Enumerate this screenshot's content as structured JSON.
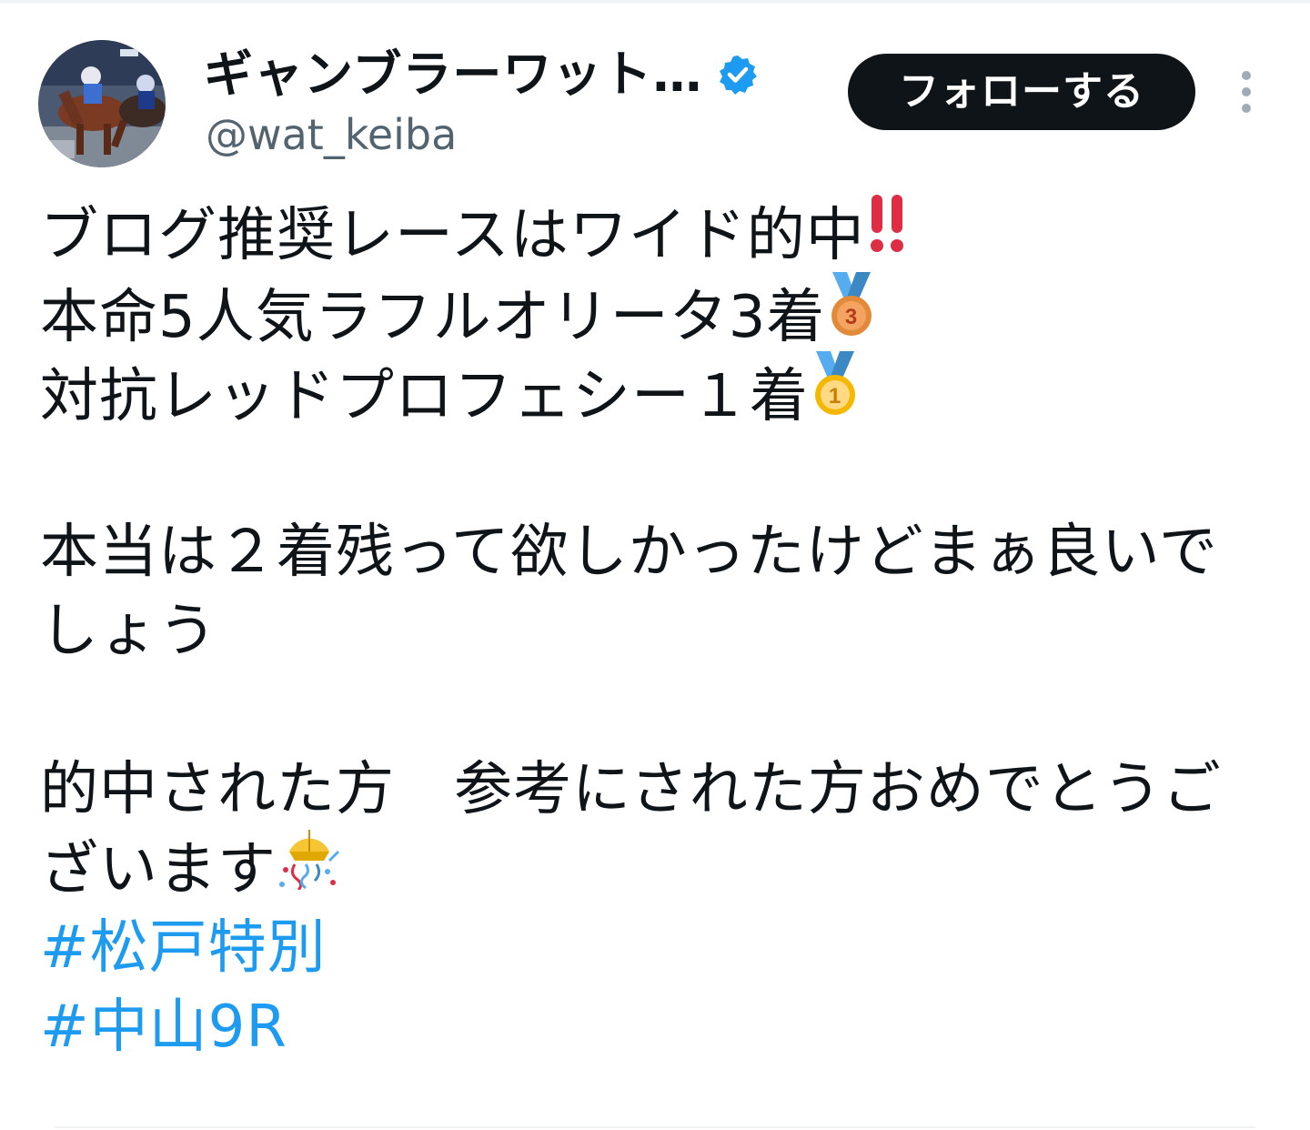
{
  "author": {
    "display_name": "ギャンブラーワット…",
    "handle": "@wat_keiba",
    "verified": true
  },
  "follow_button_label": "フォローする",
  "tweet": {
    "line1": "ブログ推奨レースはワイド的中",
    "line2": "本命5人気ラフルオリータ3着",
    "line3": "対抗レッドプロフェシー１着",
    "line4": "本当は２着残って欲しかったけどまぁ良いで",
    "line5": "しょう",
    "line6": "的中された方　参考にされた方おめでとうご",
    "line7": "ざいます",
    "hashtag1": "#松戸特別",
    "hashtag2": "#中山9R"
  },
  "icons": {
    "verified": "verified-badge-icon",
    "more": "more-vertical-icon",
    "exclamation": "double-exclamation-emoji",
    "bronze": "bronze-medal-emoji",
    "gold": "gold-medal-emoji",
    "party": "confetti-ball-emoji"
  },
  "colors": {
    "text": "#0f1419",
    "secondary_text": "#536471",
    "link": "#1d9bf0",
    "verified": "#1d9bf0",
    "button_bg": "#0f1419",
    "button_text": "#ffffff"
  }
}
